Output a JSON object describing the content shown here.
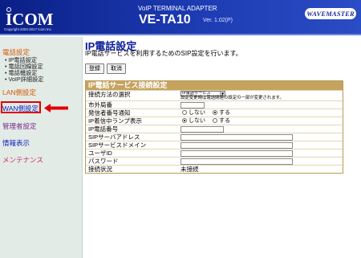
{
  "header": {
    "brand": "ICOM",
    "copyright": "Copyright 2003-2017 Icom Inc.",
    "product_sub": "VoIP TERMINAL ADAPTER",
    "product_name": "VE-TA10",
    "version": "Ver. 1.02(P)",
    "partner_logo": "WAVEMASTER"
  },
  "sidebar": {
    "phone_settings": "電話設定",
    "phone_items": [
      "IP電話設定",
      "電話回線設定",
      "電話機設定",
      "VoIP詳細設定"
    ],
    "lan": "LAN側設定",
    "wan": "WAN側設定",
    "admin": "管理者設定",
    "info": "情報表示",
    "maintenance": "メンテナンス"
  },
  "main": {
    "title": "IP電話設定",
    "description": "IP電話サービスを利用するためのSIP設定を行います。",
    "save_label": "登録",
    "cancel_label": "取消",
    "section_title": "IP電話サービス接続設定",
    "rows": {
      "method_label": "接続方法の選択",
      "method_value": "IP電話サービス",
      "method_note": "設定変更時は電話関連の設定の一部が変更されます。",
      "outside_label": "市外局番",
      "caller_label": "発信者番号通知",
      "lamp_label": "IP着信中ランプ表示",
      "radio_off": "しない",
      "radio_on": "する",
      "ip_number_label": "IP電話番号",
      "sip_address_label": "SIPサーバアドレス",
      "sip_domain_label": "SIPサービスドメイン",
      "user_id_label": "ユーザID",
      "password_label": "パスワード",
      "status_label": "接続状況",
      "status_value": "未接続"
    },
    "caller_selected": "on",
    "lamp_selected": "off"
  },
  "colors": {
    "header_bg": "#0a1f86",
    "sidebar_bg": "#e3ebe7",
    "section_header": "#c5a35f",
    "highlight": "#e00000"
  }
}
